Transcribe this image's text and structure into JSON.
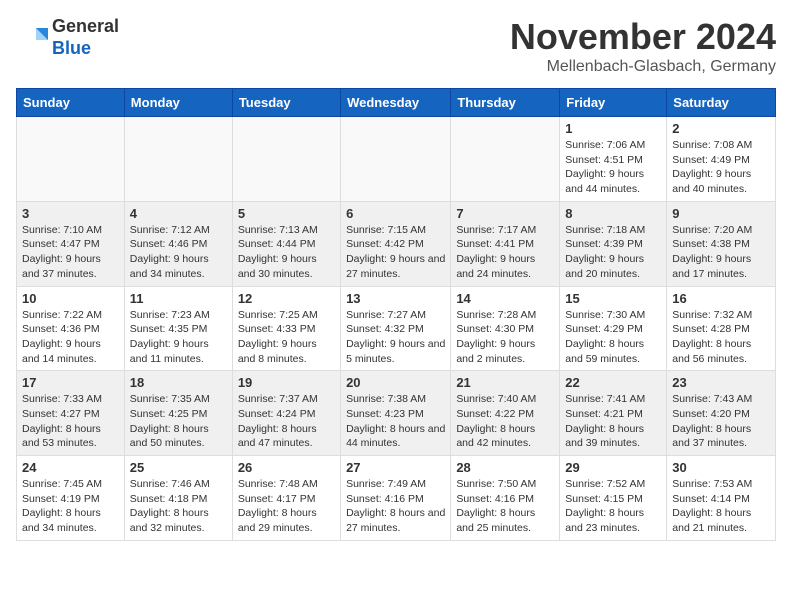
{
  "header": {
    "logo_line1": "General",
    "logo_line2": "Blue",
    "month": "November 2024",
    "location": "Mellenbach-Glasbach, Germany"
  },
  "columns": [
    "Sunday",
    "Monday",
    "Tuesday",
    "Wednesday",
    "Thursday",
    "Friday",
    "Saturday"
  ],
  "weeks": [
    [
      {
        "day": "",
        "info": ""
      },
      {
        "day": "",
        "info": ""
      },
      {
        "day": "",
        "info": ""
      },
      {
        "day": "",
        "info": ""
      },
      {
        "day": "",
        "info": ""
      },
      {
        "day": "1",
        "info": "Sunrise: 7:06 AM\nSunset: 4:51 PM\nDaylight: 9 hours and 44 minutes."
      },
      {
        "day": "2",
        "info": "Sunrise: 7:08 AM\nSunset: 4:49 PM\nDaylight: 9 hours and 40 minutes."
      }
    ],
    [
      {
        "day": "3",
        "info": "Sunrise: 7:10 AM\nSunset: 4:47 PM\nDaylight: 9 hours and 37 minutes."
      },
      {
        "day": "4",
        "info": "Sunrise: 7:12 AM\nSunset: 4:46 PM\nDaylight: 9 hours and 34 minutes."
      },
      {
        "day": "5",
        "info": "Sunrise: 7:13 AM\nSunset: 4:44 PM\nDaylight: 9 hours and 30 minutes."
      },
      {
        "day": "6",
        "info": "Sunrise: 7:15 AM\nSunset: 4:42 PM\nDaylight: 9 hours and 27 minutes."
      },
      {
        "day": "7",
        "info": "Sunrise: 7:17 AM\nSunset: 4:41 PM\nDaylight: 9 hours and 24 minutes."
      },
      {
        "day": "8",
        "info": "Sunrise: 7:18 AM\nSunset: 4:39 PM\nDaylight: 9 hours and 20 minutes."
      },
      {
        "day": "9",
        "info": "Sunrise: 7:20 AM\nSunset: 4:38 PM\nDaylight: 9 hours and 17 minutes."
      }
    ],
    [
      {
        "day": "10",
        "info": "Sunrise: 7:22 AM\nSunset: 4:36 PM\nDaylight: 9 hours and 14 minutes."
      },
      {
        "day": "11",
        "info": "Sunrise: 7:23 AM\nSunset: 4:35 PM\nDaylight: 9 hours and 11 minutes."
      },
      {
        "day": "12",
        "info": "Sunrise: 7:25 AM\nSunset: 4:33 PM\nDaylight: 9 hours and 8 minutes."
      },
      {
        "day": "13",
        "info": "Sunrise: 7:27 AM\nSunset: 4:32 PM\nDaylight: 9 hours and 5 minutes."
      },
      {
        "day": "14",
        "info": "Sunrise: 7:28 AM\nSunset: 4:30 PM\nDaylight: 9 hours and 2 minutes."
      },
      {
        "day": "15",
        "info": "Sunrise: 7:30 AM\nSunset: 4:29 PM\nDaylight: 8 hours and 59 minutes."
      },
      {
        "day": "16",
        "info": "Sunrise: 7:32 AM\nSunset: 4:28 PM\nDaylight: 8 hours and 56 minutes."
      }
    ],
    [
      {
        "day": "17",
        "info": "Sunrise: 7:33 AM\nSunset: 4:27 PM\nDaylight: 8 hours and 53 minutes."
      },
      {
        "day": "18",
        "info": "Sunrise: 7:35 AM\nSunset: 4:25 PM\nDaylight: 8 hours and 50 minutes."
      },
      {
        "day": "19",
        "info": "Sunrise: 7:37 AM\nSunset: 4:24 PM\nDaylight: 8 hours and 47 minutes."
      },
      {
        "day": "20",
        "info": "Sunrise: 7:38 AM\nSunset: 4:23 PM\nDaylight: 8 hours and 44 minutes."
      },
      {
        "day": "21",
        "info": "Sunrise: 7:40 AM\nSunset: 4:22 PM\nDaylight: 8 hours and 42 minutes."
      },
      {
        "day": "22",
        "info": "Sunrise: 7:41 AM\nSunset: 4:21 PM\nDaylight: 8 hours and 39 minutes."
      },
      {
        "day": "23",
        "info": "Sunrise: 7:43 AM\nSunset: 4:20 PM\nDaylight: 8 hours and 37 minutes."
      }
    ],
    [
      {
        "day": "24",
        "info": "Sunrise: 7:45 AM\nSunset: 4:19 PM\nDaylight: 8 hours and 34 minutes."
      },
      {
        "day": "25",
        "info": "Sunrise: 7:46 AM\nSunset: 4:18 PM\nDaylight: 8 hours and 32 minutes."
      },
      {
        "day": "26",
        "info": "Sunrise: 7:48 AM\nSunset: 4:17 PM\nDaylight: 8 hours and 29 minutes."
      },
      {
        "day": "27",
        "info": "Sunrise: 7:49 AM\nSunset: 4:16 PM\nDaylight: 8 hours and 27 minutes."
      },
      {
        "day": "28",
        "info": "Sunrise: 7:50 AM\nSunset: 4:16 PM\nDaylight: 8 hours and 25 minutes."
      },
      {
        "day": "29",
        "info": "Sunrise: 7:52 AM\nSunset: 4:15 PM\nDaylight: 8 hours and 23 minutes."
      },
      {
        "day": "30",
        "info": "Sunrise: 7:53 AM\nSunset: 4:14 PM\nDaylight: 8 hours and 21 minutes."
      }
    ]
  ]
}
